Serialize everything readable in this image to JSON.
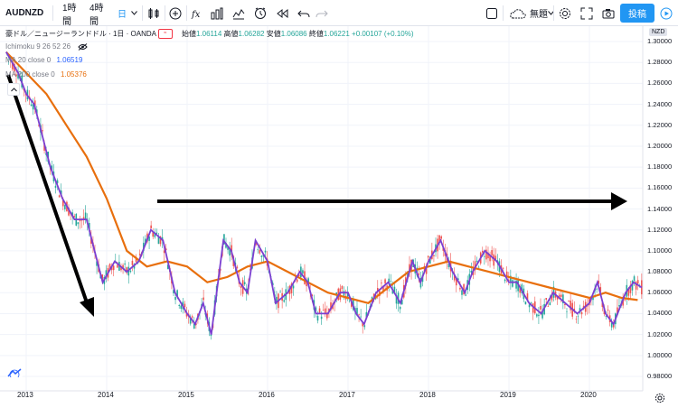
{
  "toolbar": {
    "symbol": "AUDNZD",
    "timeframes": [
      "1時間",
      "4時間",
      "日"
    ],
    "active_timeframe": "日",
    "layout_name": "無題",
    "publish_label": "投稿"
  },
  "legend": {
    "title": "豪ドル／ニュージーランドドル · 1日 · OANDA",
    "open_label": "始値",
    "open": "1.06114",
    "high_label": "高値",
    "high": "1.06282",
    "low_label": "安値",
    "low": "1.06086",
    "close_label": "終値",
    "close": "1.06221",
    "change": "+0.00107 (+0.10%)",
    "indicators": [
      {
        "name": "Ichimoku 9 26 52 26",
        "value": ""
      },
      {
        "name": "MA 20 close 0",
        "value": "1.06519",
        "color": "#2962ff"
      },
      {
        "name": "MA 200 close 0",
        "value": "1.05376",
        "color": "#e86f0d"
      }
    ]
  },
  "price_axis": {
    "currency": "NZD",
    "labels": [
      "1.30000",
      "1.28000",
      "1.26000",
      "1.24000",
      "1.22000",
      "1.20000",
      "1.18000",
      "1.16000",
      "1.14000",
      "1.12000",
      "1.10000",
      "1.08000",
      "1.06000",
      "1.04000",
      "1.02000",
      "1.00000",
      "0.98000"
    ]
  },
  "time_axis": {
    "labels": [
      "2013",
      "2014",
      "2015",
      "2016",
      "2017",
      "2018",
      "2019",
      "2020"
    ]
  },
  "colors": {
    "up": "#26a69a",
    "down": "#ef5350",
    "ma20": "#7b3fd1",
    "ma200": "#e86f0d",
    "accent": "#2196f3"
  },
  "chart_data": {
    "type": "line",
    "title": "豪ドル／ニュージーランドドル · 1日 · OANDA",
    "xlim": [
      2012.75,
      2020.7
    ],
    "ylim": [
      0.98,
      1.3
    ],
    "series": [
      {
        "name": "MA 20 close 0",
        "x": [
          2012.75,
          2012.9,
          2013.0,
          2013.1,
          2013.2,
          2013.3,
          2013.45,
          2013.6,
          2013.75,
          2013.85,
          2013.95,
          2014.1,
          2014.25,
          2014.4,
          2014.55,
          2014.7,
          2014.85,
          2015.0,
          2015.1,
          2015.2,
          2015.3,
          2015.45,
          2015.55,
          2015.65,
          2015.75,
          2015.85,
          2016.0,
          2016.1,
          2016.25,
          2016.4,
          2016.5,
          2016.6,
          2016.75,
          2016.9,
          2017.0,
          2017.1,
          2017.2,
          2017.35,
          2017.5,
          2017.65,
          2017.8,
          2017.9,
          2018.0,
          2018.15,
          2018.3,
          2018.45,
          2018.55,
          2018.7,
          2018.85,
          2019.0,
          2019.1,
          2019.25,
          2019.4,
          2019.55,
          2019.7,
          2019.85,
          2020.0,
          2020.1,
          2020.2,
          2020.3,
          2020.45,
          2020.55,
          2020.65
        ],
        "values": [
          1.29,
          1.27,
          1.25,
          1.24,
          1.21,
          1.18,
          1.15,
          1.13,
          1.13,
          1.1,
          1.07,
          1.09,
          1.08,
          1.09,
          1.12,
          1.11,
          1.06,
          1.04,
          1.03,
          1.05,
          1.02,
          1.11,
          1.1,
          1.07,
          1.06,
          1.11,
          1.09,
          1.05,
          1.06,
          1.08,
          1.07,
          1.04,
          1.04,
          1.06,
          1.06,
          1.04,
          1.03,
          1.06,
          1.07,
          1.05,
          1.09,
          1.07,
          1.09,
          1.11,
          1.08,
          1.06,
          1.08,
          1.1,
          1.09,
          1.07,
          1.07,
          1.05,
          1.04,
          1.06,
          1.05,
          1.04,
          1.05,
          1.07,
          1.04,
          1.03,
          1.06,
          1.07,
          1.065
        ]
      },
      {
        "name": "MA 200 close 0",
        "x": [
          2012.75,
          2013.0,
          2013.25,
          2013.5,
          2013.75,
          2014.0,
          2014.25,
          2014.5,
          2014.75,
          2015.0,
          2015.25,
          2015.5,
          2015.75,
          2016.0,
          2016.25,
          2016.5,
          2016.75,
          2017.0,
          2017.25,
          2017.5,
          2017.75,
          2018.0,
          2018.25,
          2018.5,
          2018.75,
          2019.0,
          2019.25,
          2019.5,
          2019.75,
          2020.0,
          2020.2,
          2020.4,
          2020.6
        ],
        "values": [
          1.29,
          1.27,
          1.25,
          1.22,
          1.19,
          1.15,
          1.1,
          1.085,
          1.09,
          1.085,
          1.07,
          1.075,
          1.085,
          1.09,
          1.08,
          1.07,
          1.06,
          1.055,
          1.05,
          1.065,
          1.08,
          1.085,
          1.09,
          1.085,
          1.08,
          1.075,
          1.07,
          1.065,
          1.06,
          1.055,
          1.06,
          1.055,
          1.053
        ]
      }
    ]
  }
}
